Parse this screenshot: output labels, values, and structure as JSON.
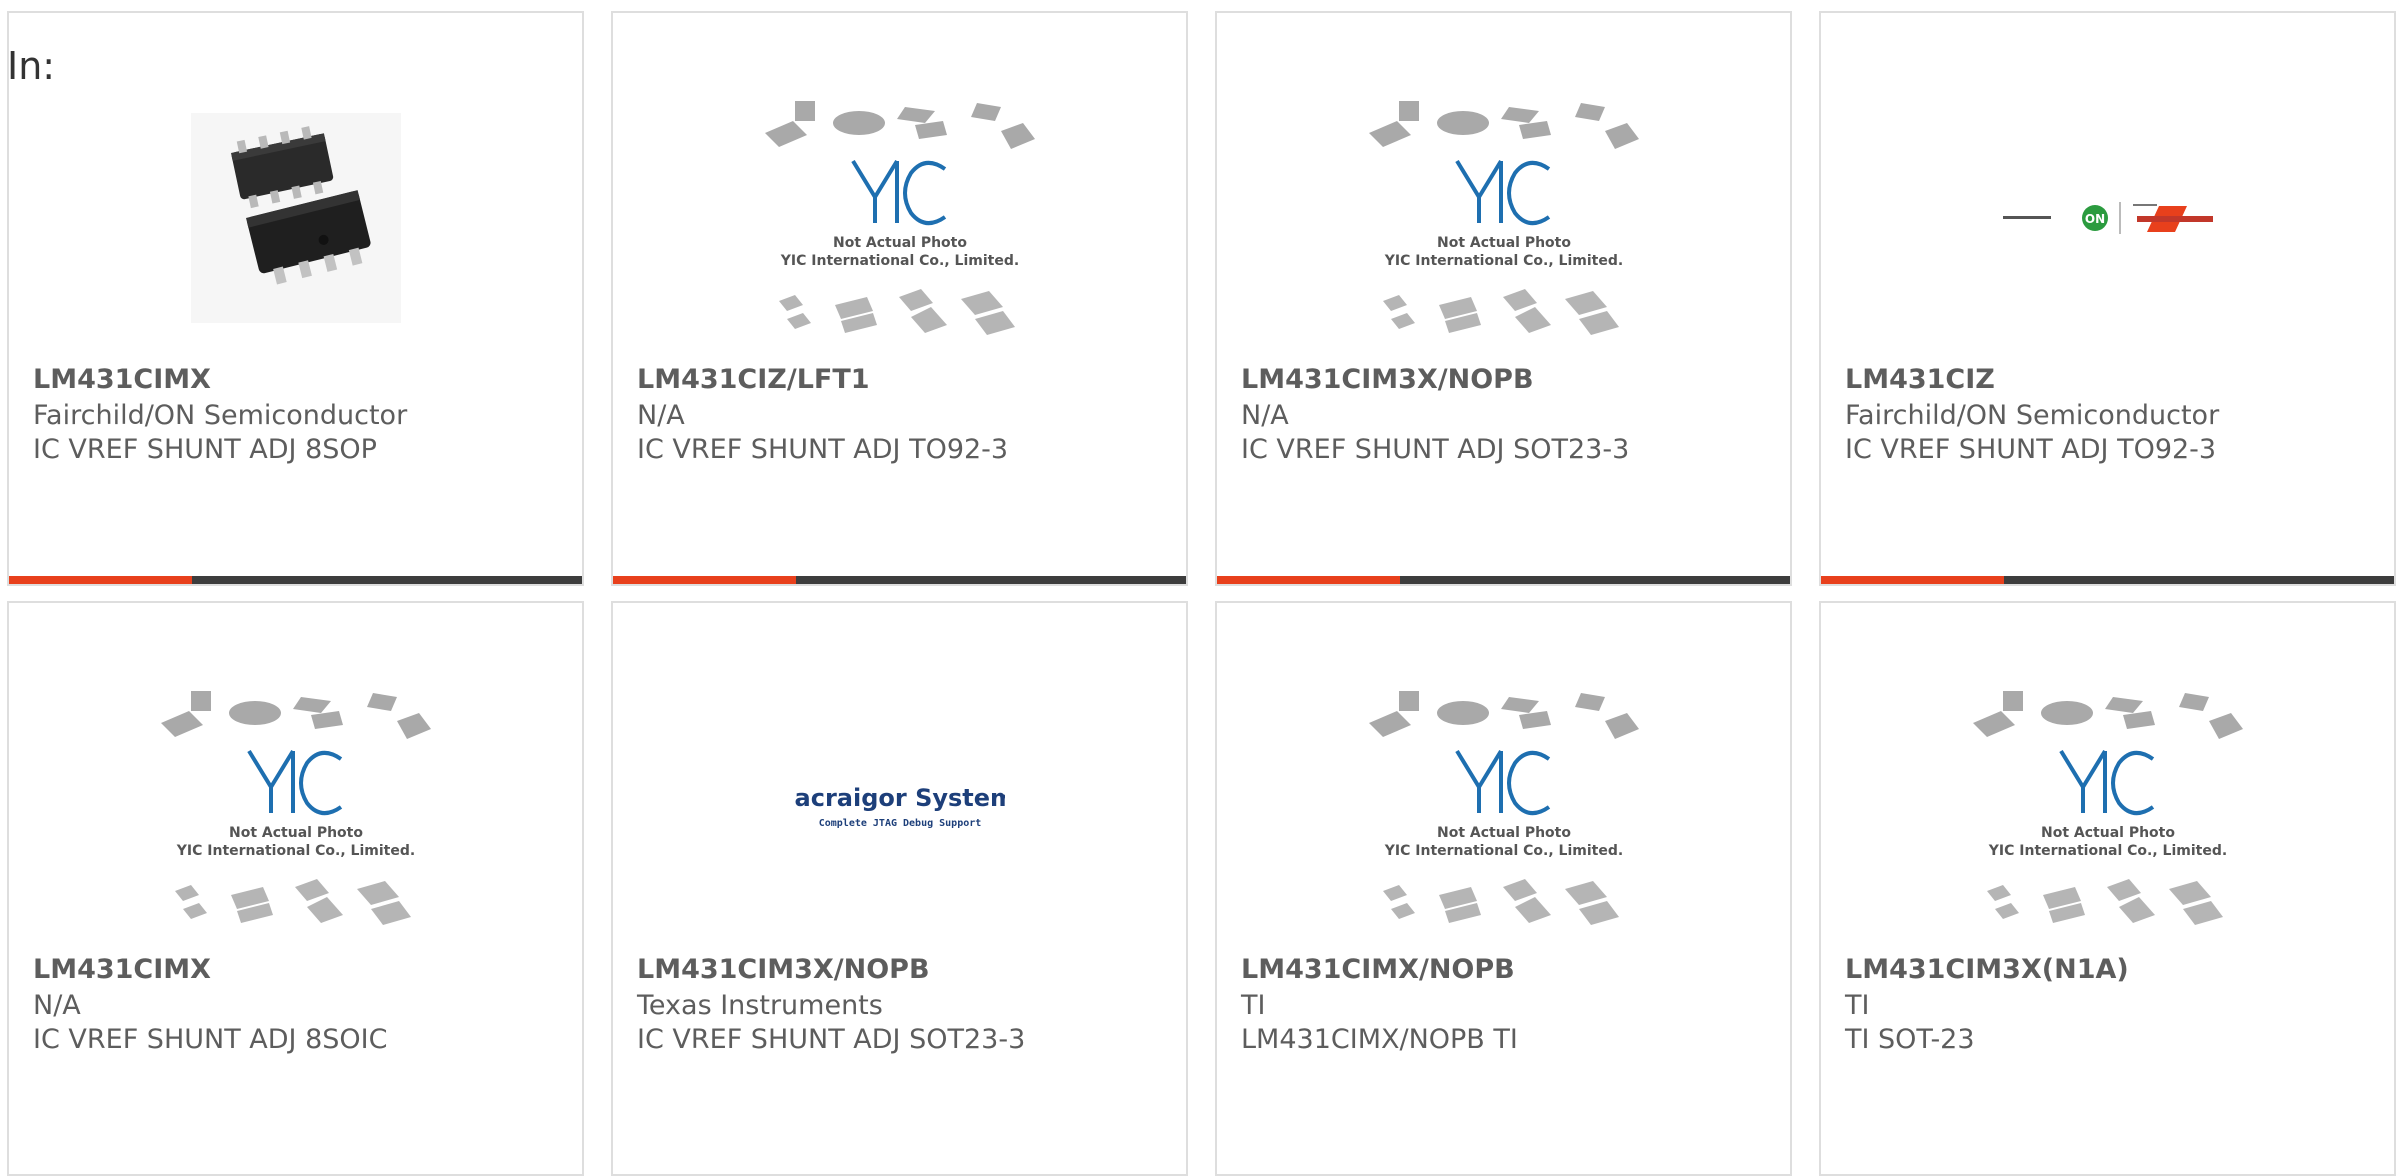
{
  "filter": {
    "label": "In:"
  },
  "theme": {
    "accent": "#e8401c",
    "bar": "#3d3d3d",
    "text": "#5d5d5d",
    "border": "#dedede"
  },
  "products": [
    {
      "part_number": "LM431CIMX",
      "manufacturer": "Fairchild/ON Semiconductor",
      "description": "IC VREF SHUNT ADJ 8SOP",
      "image": "ic-8sop-photo"
    },
    {
      "part_number": "LM431CIZ/LFT1",
      "manufacturer": "N/A",
      "description": "IC VREF SHUNT ADJ TO92-3",
      "image": "yic-placeholder",
      "placeholder_caption": "Not Actual Photo",
      "placeholder_company": "YIC International Co., Limited."
    },
    {
      "part_number": "LM431CIM3X/NOPB",
      "manufacturer": "N/A",
      "description": "IC VREF SHUNT ADJ SOT23-3",
      "image": "yic-placeholder",
      "placeholder_caption": "Not Actual Photo",
      "placeholder_company": "YIC International Co., Limited."
    },
    {
      "part_number": "LM431CIZ",
      "manufacturer": "Fairchild/ON Semiconductor",
      "description": "IC VREF SHUNT ADJ TO92-3",
      "image": "on-fairchild-logo"
    },
    {
      "part_number": "LM431CIMX",
      "manufacturer": "N/A",
      "description": "IC VREF SHUNT ADJ 8SOIC",
      "image": "yic-placeholder",
      "placeholder_caption": "Not Actual Photo",
      "placeholder_company": "YIC International Co., Limited."
    },
    {
      "part_number": "LM431CIM3X/NOPB",
      "manufacturer": "Texas Instruments",
      "description": "IC VREF SHUNT ADJ SOT23-3",
      "image": "macraigor-logo",
      "logo_title": "Macraigor Systems",
      "logo_tagline": "Complete JTAG Debug Support"
    },
    {
      "part_number": "LM431CIMX/NOPB",
      "manufacturer": "TI",
      "description": "LM431CIMX/NOPB TI",
      "image": "yic-placeholder",
      "placeholder_caption": "Not Actual Photo",
      "placeholder_company": "YIC International Co., Limited."
    },
    {
      "part_number": "LM431CIM3X(N1A)",
      "manufacturer": "TI",
      "description": "TI SOT-23",
      "image": "yic-placeholder",
      "placeholder_caption": "Not Actual Photo",
      "placeholder_company": "YIC International Co., Limited."
    }
  ]
}
